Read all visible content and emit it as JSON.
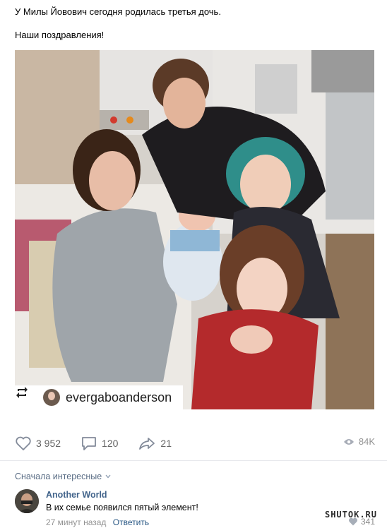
{
  "post": {
    "line1": "У Милы Йовович сегодня родилась третья дочь.",
    "line2": "Наши поздравления!"
  },
  "photo": {
    "tag_username": "evergaboanderson",
    "icons": {
      "repost": "repost-arrows-icon"
    }
  },
  "actions": {
    "likes": "3 952",
    "comments": "120",
    "shares": "21",
    "views": "84K"
  },
  "comments_section": {
    "sort_label": "Сначала интересные",
    "items": [
      {
        "author": "Another World",
        "text": "В их семье появился пятый элемент!",
        "time": "27 минут назад",
        "reply_label": "Ответить",
        "likes": "341"
      }
    ]
  },
  "watermark": "SHUTOK.RU",
  "colors": {
    "link": "#42648b",
    "reply": "#2a5885",
    "muted": "#939393",
    "divider": "#e7e8ec"
  }
}
